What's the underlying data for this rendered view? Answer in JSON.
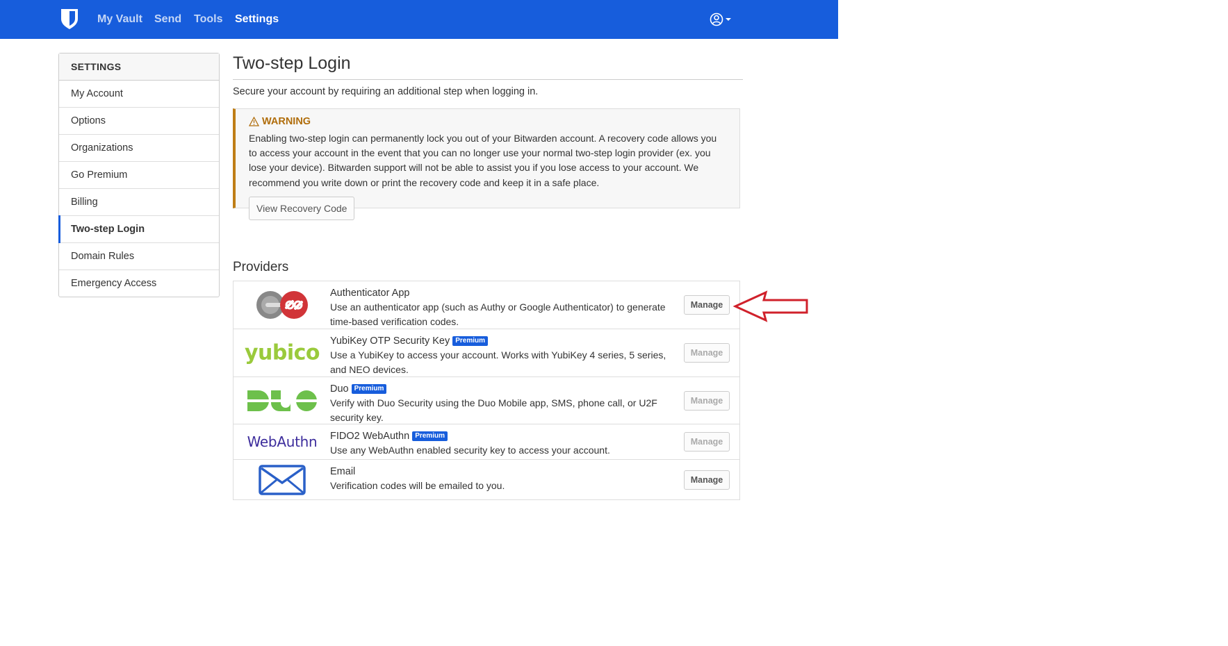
{
  "nav": {
    "links": [
      "My Vault",
      "Send",
      "Tools",
      "Settings"
    ]
  },
  "sidebar": {
    "header": "SETTINGS",
    "items": [
      {
        "label": "My Account"
      },
      {
        "label": "Options"
      },
      {
        "label": "Organizations"
      },
      {
        "label": "Go Premium"
      },
      {
        "label": "Billing"
      },
      {
        "label": "Two-step Login",
        "active": true
      },
      {
        "label": "Domain Rules"
      },
      {
        "label": "Emergency Access"
      }
    ]
  },
  "main": {
    "title": "Two-step Login",
    "subtitle": "Secure your account by requiring an additional step when logging in.",
    "warning": {
      "title": "WARNING",
      "text": "Enabling two-step login can permanently lock you out of your Bitwarden account. A recovery code allows you to access your account in the event that you can no longer use your normal two-step login provider (ex. you lose your device). Bitwarden support will not be able to assist you if you lose access to your account. We recommend you write down or print the recovery code and keep it in a safe place.",
      "button": "View Recovery Code"
    },
    "providers_title": "Providers",
    "providers": [
      {
        "name": "Authenticator App",
        "badge": "",
        "desc": "Use an authenticator app (such as Authy or Google Authenticator) to generate time-based verification codes.",
        "button": "Manage",
        "logo_text": ""
      },
      {
        "name": "YubiKey OTP Security Key",
        "badge": "Premium",
        "desc": "Use a YubiKey to access your account. Works with YubiKey 4 series, 5 series, and NEO devices.",
        "button": "Manage",
        "logo_text": "yubico"
      },
      {
        "name": "Duo",
        "badge": "Premium",
        "desc": "Verify with Duo Security using the Duo Mobile app, SMS, phone call, or U2F security key.",
        "button": "Manage",
        "logo_text": "DUO"
      },
      {
        "name": "FIDO2 WebAuthn",
        "badge": "Premium",
        "desc": "Use any WebAuthn enabled security key to access your account.",
        "button": "Manage",
        "logo_text": "WebAuthn"
      },
      {
        "name": "Email",
        "badge": "",
        "desc": "Verification codes will be emailed to you.",
        "button": "Manage",
        "logo_text": ""
      }
    ]
  },
  "colors": {
    "brand": "#175ddc",
    "warning": "#bf7e16",
    "annotation_arrow": "#d0212b"
  }
}
